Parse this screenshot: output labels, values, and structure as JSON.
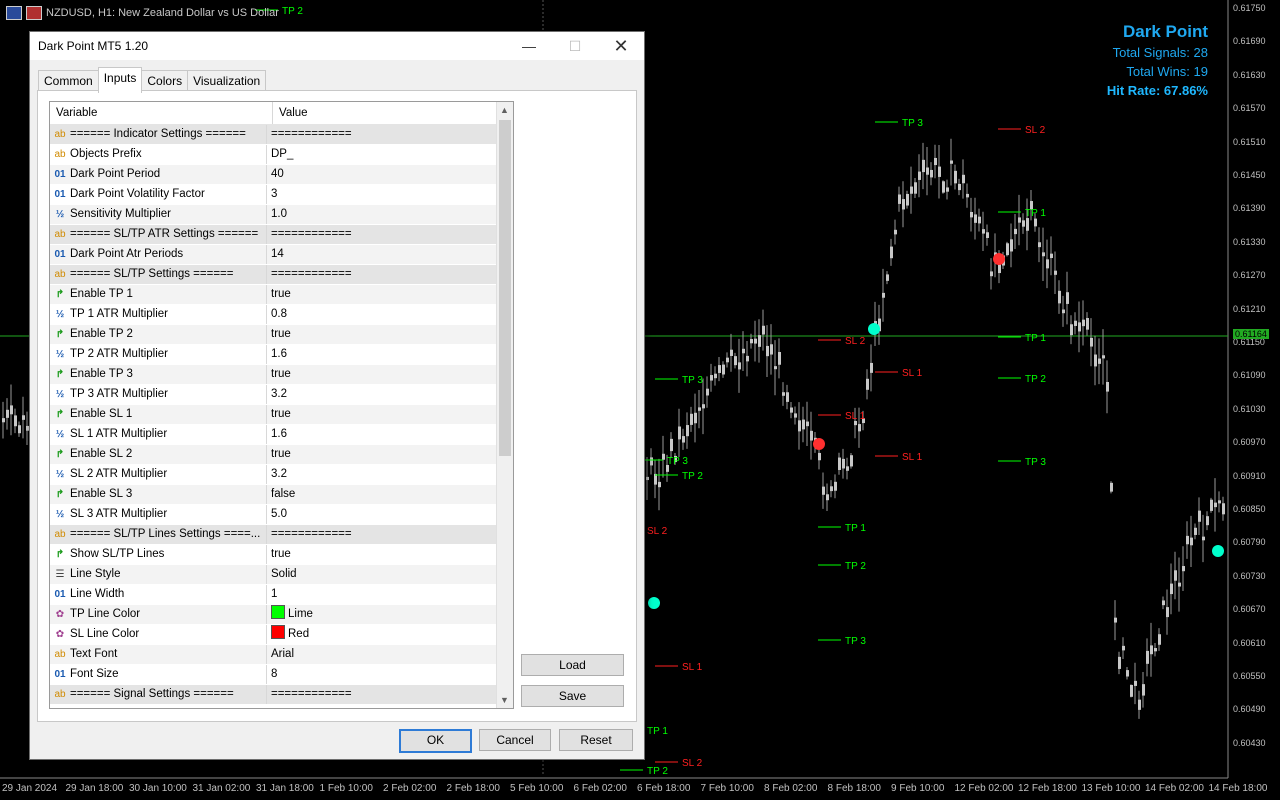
{
  "window": {
    "chart_title": "NZDUSD, H1:  New Zealand Dollar vs US Dollar"
  },
  "stats": {
    "title": "Dark Point",
    "total_signals": "Total Signals: 28",
    "total_wins": "Total Wins: 19",
    "hit_rate": "Hit Rate: 67.86%"
  },
  "colors": {
    "tp": "#00ff00",
    "sl": "#ff2020",
    "signal_buy": "#00ffcc",
    "signal_sell": "#ff3030",
    "stats": "#1fa8f0",
    "current_price": "#22aa22"
  },
  "price_axis": [
    "0.61750",
    "0.61690",
    "0.61630",
    "0.61570",
    "0.61510",
    "0.61450",
    "0.61390",
    "0.61330",
    "0.61270",
    "0.61210",
    "0.61150",
    "0.61090",
    "0.61030",
    "0.60970",
    "0.60910",
    "0.60850",
    "0.60790",
    "0.60730",
    "0.60670",
    "0.60610",
    "0.60550",
    "0.60490",
    "0.60430"
  ],
  "current_price": "0.61164",
  "time_axis": [
    "29 Jan 2024",
    "29 Jan 18:00",
    "30 Jan 10:00",
    "31 Jan 02:00",
    "31 Jan 18:00",
    "1 Feb 10:00",
    "2 Feb 02:00",
    "2 Feb 18:00",
    "5 Feb 10:00",
    "6 Feb 02:00",
    "6 Feb 18:00",
    "7 Feb 10:00",
    "8 Feb 02:00",
    "8 Feb 18:00",
    "9 Feb 10:00",
    "12 Feb 02:00",
    "12 Feb 18:00",
    "13 Feb 10:00",
    "14 Feb 02:00",
    "14 Feb 18:00"
  ],
  "chart_labels": [
    {
      "text": "TP 2",
      "kind": "tp"
    },
    {
      "text": "TP 3",
      "kind": "tp"
    },
    {
      "text": "SL 2",
      "kind": "sl"
    },
    {
      "text": "TP 3",
      "kind": "tp"
    },
    {
      "text": "SL 1",
      "kind": "sl"
    },
    {
      "text": "TP 1",
      "kind": "tp"
    },
    {
      "text": "SL 2",
      "kind": "sl"
    },
    {
      "text": "TP 1",
      "kind": "tp"
    },
    {
      "text": "SL 1",
      "kind": "sl"
    },
    {
      "text": "TP 2",
      "kind": "tp"
    },
    {
      "text": "TP 3",
      "kind": "tp"
    },
    {
      "text": "SL 1",
      "kind": "sl"
    },
    {
      "text": "SL 2",
      "kind": "sl"
    },
    {
      "text": "TP 3",
      "kind": "tp"
    },
    {
      "text": "TP 2",
      "kind": "tp"
    },
    {
      "text": "TP 1",
      "kind": "tp"
    },
    {
      "text": "TP 2",
      "kind": "tp"
    },
    {
      "text": "TP 3",
      "kind": "tp"
    },
    {
      "text": "SL 1",
      "kind": "sl"
    },
    {
      "text": "TP 1",
      "kind": "tp"
    },
    {
      "text": "SL 2",
      "kind": "sl"
    },
    {
      "text": "TP 2",
      "kind": "tp"
    }
  ],
  "dialog": {
    "title": "Dark Point MT5 1.20",
    "tabs": [
      "Common",
      "Inputs",
      "Colors",
      "Visualization"
    ],
    "active_tab": "Inputs",
    "col_variable": "Variable",
    "col_value": "Value",
    "rows": [
      {
        "icon": "ab",
        "name": "====== Indicator Settings ======",
        "value": "============",
        "hdr": true
      },
      {
        "icon": "ab",
        "name": "Objects Prefix",
        "value": "DP_"
      },
      {
        "icon": "01",
        "name": "Dark Point Period",
        "value": "40"
      },
      {
        "icon": "01",
        "name": "Dark Point Volatility Factor",
        "value": "3"
      },
      {
        "icon": "half",
        "name": "Sensitivity Multiplier",
        "value": "1.0"
      },
      {
        "icon": "ab",
        "name": "====== SL/TP ATR Settings ======",
        "value": "============",
        "hdr": true
      },
      {
        "icon": "01",
        "name": "Dark Point Atr Periods",
        "value": "14"
      },
      {
        "icon": "ab",
        "name": "====== SL/TP Settings ======",
        "value": "============",
        "hdr": true
      },
      {
        "icon": "bool",
        "name": "Enable TP 1",
        "value": "true"
      },
      {
        "icon": "half",
        "name": "TP 1 ATR Multiplier",
        "value": "0.8"
      },
      {
        "icon": "bool",
        "name": "Enable TP 2",
        "value": "true"
      },
      {
        "icon": "half",
        "name": "TP 2 ATR Multiplier",
        "value": "1.6"
      },
      {
        "icon": "bool",
        "name": "Enable TP 3",
        "value": "true"
      },
      {
        "icon": "half",
        "name": "TP 3 ATR Multiplier",
        "value": "3.2"
      },
      {
        "icon": "bool",
        "name": "Enable SL 1",
        "value": "true"
      },
      {
        "icon": "half",
        "name": "SL 1 ATR Multiplier",
        "value": "1.6"
      },
      {
        "icon": "bool",
        "name": "Enable SL 2",
        "value": "true"
      },
      {
        "icon": "half",
        "name": "SL 2 ATR Multiplier",
        "value": "3.2"
      },
      {
        "icon": "bool",
        "name": "Enable SL 3",
        "value": "false"
      },
      {
        "icon": "half",
        "name": "SL 3 ATR Multiplier",
        "value": "5.0"
      },
      {
        "icon": "ab",
        "name": "====== SL/TP Lines Settings ====...",
        "value": "============",
        "hdr": true
      },
      {
        "icon": "bool",
        "name": "Show SL/TP Lines",
        "value": "true"
      },
      {
        "icon": "list",
        "name": "Line Style",
        "value": "Solid"
      },
      {
        "icon": "01",
        "name": "Line Width",
        "value": "1"
      },
      {
        "icon": "color",
        "name": "TP Line Color",
        "value": "Lime",
        "swatch": "#00ff00"
      },
      {
        "icon": "color",
        "name": "SL Line Color",
        "value": "Red",
        "swatch": "#ff0000"
      },
      {
        "icon": "ab",
        "name": "Text Font",
        "value": "Arial"
      },
      {
        "icon": "01",
        "name": "Font Size",
        "value": "8"
      },
      {
        "icon": "ab",
        "name": "====== Signal Settings ======",
        "value": "============",
        "hdr": true
      }
    ],
    "load_label": "Load",
    "save_label": "Save",
    "ok_label": "OK",
    "cancel_label": "Cancel",
    "reset_label": "Reset"
  }
}
